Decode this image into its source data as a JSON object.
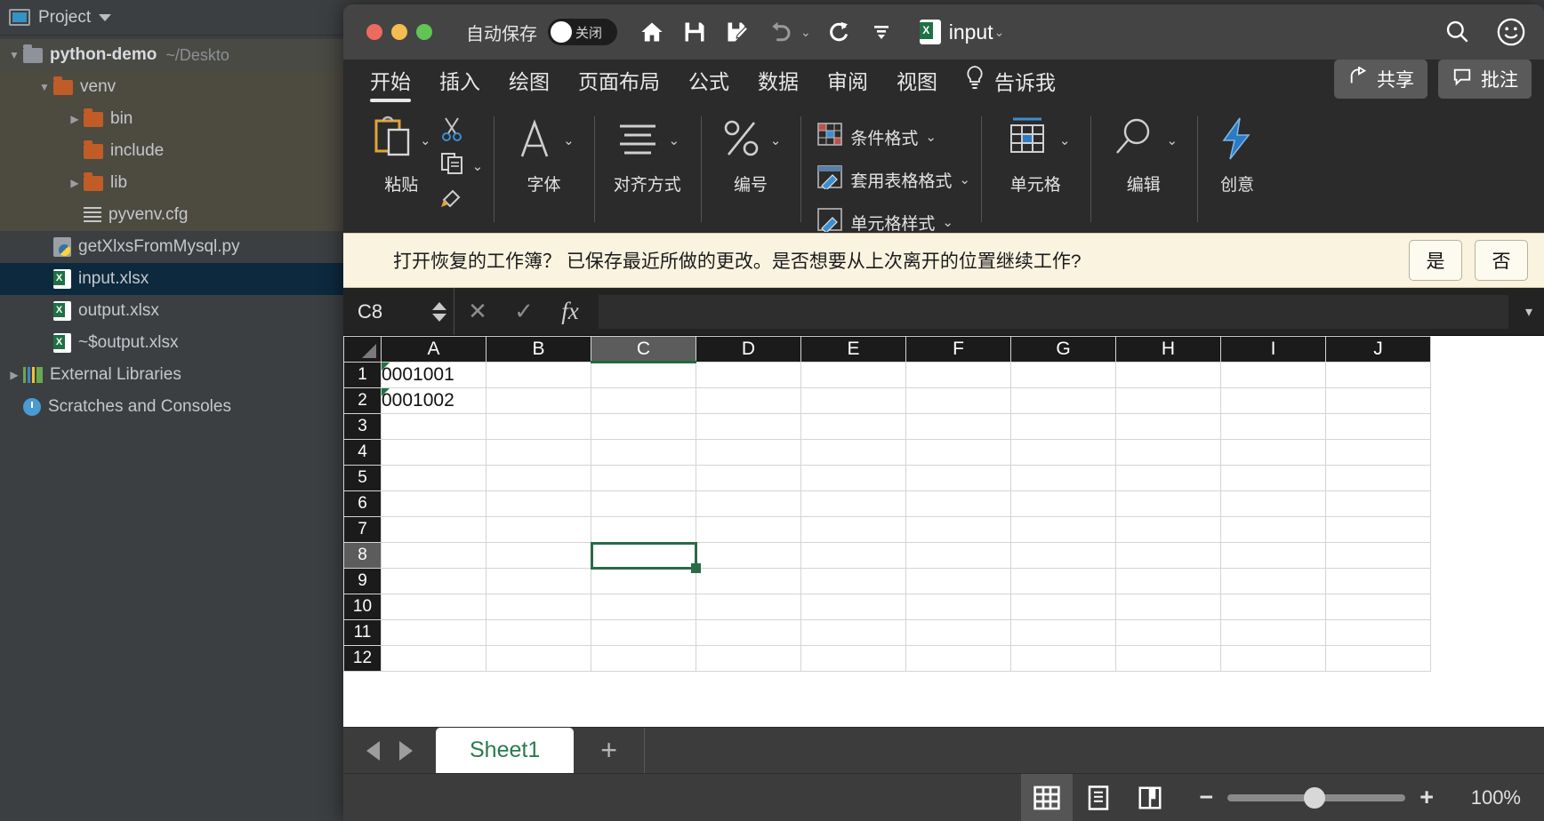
{
  "ide": {
    "panel_title": "Project",
    "tree": [
      {
        "label": "python-demo",
        "suffix": "~/Deskto",
        "icon": "folder-blue-icon",
        "twisty": "down",
        "indent": 0,
        "bold": true,
        "state": "group"
      },
      {
        "label": "venv",
        "suffix": "",
        "icon": "folder-orange-icon",
        "twisty": "down",
        "indent": 1,
        "bold": false,
        "state": "group"
      },
      {
        "label": "bin",
        "suffix": "",
        "icon": "folder-orange-icon",
        "twisty": "right",
        "indent": 2,
        "bold": false,
        "state": "group"
      },
      {
        "label": "include",
        "suffix": "",
        "icon": "folder-orange-icon",
        "twisty": "",
        "indent": 2,
        "bold": false,
        "state": "group"
      },
      {
        "label": "lib",
        "suffix": "",
        "icon": "folder-orange-icon",
        "twisty": "right",
        "indent": 2,
        "bold": false,
        "state": "group"
      },
      {
        "label": "pyvenv.cfg",
        "suffix": "",
        "icon": "config-file-icon",
        "twisty": "",
        "indent": 2,
        "bold": false,
        "state": "group"
      },
      {
        "label": "getXlxsFromMysql.py",
        "suffix": "",
        "icon": "python-file-icon",
        "twisty": "",
        "indent": 1,
        "bold": false,
        "state": ""
      },
      {
        "label": "input.xlsx",
        "suffix": "",
        "icon": "excel-file-icon",
        "twisty": "",
        "indent": 1,
        "bold": false,
        "state": "selected"
      },
      {
        "label": "output.xlsx",
        "suffix": "",
        "icon": "excel-file-icon",
        "twisty": "",
        "indent": 1,
        "bold": false,
        "state": ""
      },
      {
        "label": "~$output.xlsx",
        "suffix": "",
        "icon": "excel-file-icon",
        "twisty": "",
        "indent": 1,
        "bold": false,
        "state": ""
      },
      {
        "label": "External Libraries",
        "suffix": "",
        "icon": "libraries-icon",
        "twisty": "right",
        "indent": 0,
        "bold": false,
        "state": ""
      },
      {
        "label": "Scratches and Consoles",
        "suffix": "",
        "icon": "scratches-icon",
        "twisty": "",
        "indent": 0,
        "bold": false,
        "state": ""
      }
    ]
  },
  "excel": {
    "titlebar": {
      "autosave_label": "自动保存",
      "autosave_state": "关闭",
      "document_name": "input",
      "icons": [
        "home-icon",
        "save-icon",
        "save-as-icon",
        "undo-icon",
        "redo-icon",
        "customize-toolbar-icon"
      ],
      "right_icons": [
        "search-icon",
        "smiley-icon"
      ]
    },
    "tabs": [
      {
        "label": "开始",
        "active": true
      },
      {
        "label": "插入",
        "active": false
      },
      {
        "label": "绘图",
        "active": false
      },
      {
        "label": "页面布局",
        "active": false
      },
      {
        "label": "公式",
        "active": false
      },
      {
        "label": "数据",
        "active": false
      },
      {
        "label": "审阅",
        "active": false
      },
      {
        "label": "视图",
        "active": false
      }
    ],
    "tell_me": "告诉我",
    "share_label": "共享",
    "comment_label": "批注",
    "ribbon_groups": {
      "paste": "粘贴",
      "font": "字体",
      "alignment": "对齐方式",
      "number": "编号",
      "conditional_format": "条件格式",
      "table_format": "套用表格格式",
      "cell_styles": "单元格样式",
      "cells": "单元格",
      "editing": "编辑",
      "ideas": "创意"
    },
    "notice": {
      "message": "打开恢复的工作簿？ 已保存最近所做的更改。是否想要从上次离开的位置继续工作?",
      "yes": "是",
      "no": "否"
    },
    "formula_bar": {
      "name_box": "C8",
      "cancel_icon": "cancel-icon",
      "confirm_icon": "confirm-icon",
      "function_icon": "fx",
      "formula_value": "",
      "formula_placeholder": ""
    },
    "sheet": {
      "columns": [
        "A",
        "B",
        "C",
        "D",
        "E",
        "F",
        "G",
        "H",
        "I",
        "J"
      ],
      "rows": [
        "1",
        "2",
        "3",
        "4",
        "5",
        "6",
        "7",
        "8",
        "9",
        "10",
        "11",
        "12"
      ],
      "cells": {
        "A1": "0001001",
        "A2": "0001002"
      },
      "error_cells": [
        "A1",
        "A2"
      ],
      "selected_cell": "C8",
      "selected_column": "C",
      "selected_row": "8"
    },
    "sheet_tabs": {
      "tabs": [
        "Sheet1"
      ],
      "active": "Sheet1",
      "add_label": "+"
    },
    "status_bar": {
      "views": [
        "normal-view-icon",
        "page-layout-icon",
        "page-break-icon"
      ],
      "active_view": "normal-view-icon",
      "zoom_out": "−",
      "zoom_in": "+",
      "zoom_level": "100%"
    }
  },
  "colors": {
    "ide_bg": "#3c3f41",
    "selection_blue": "#0d293e",
    "excel_green": "#1e7145",
    "notice_bg": "#faf3e0",
    "accent_blue": "#2a7ac4"
  }
}
